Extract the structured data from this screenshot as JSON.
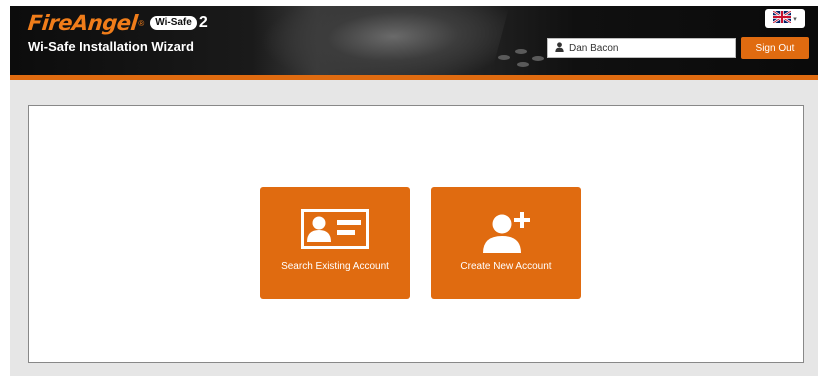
{
  "header": {
    "logo": {
      "brand": "FireAngel",
      "registered": "®",
      "badge": "Wi-Safe",
      "version": "2"
    },
    "subtitle": "Wi-Safe Installation Wizard",
    "language": {
      "icon": "uk-flag-icon",
      "caret": "▾"
    },
    "user": {
      "icon": "user-icon",
      "name": "Dan Bacon"
    },
    "sign_out_label": "Sign Out"
  },
  "tiles": [
    {
      "icon": "id-card-icon",
      "label": "Search Existing Account"
    },
    {
      "icon": "add-user-icon",
      "label": "Create New Account"
    }
  ],
  "colors": {
    "accent": "#e06b10",
    "header_bg": "#111111",
    "background": "#e6e6e6"
  }
}
